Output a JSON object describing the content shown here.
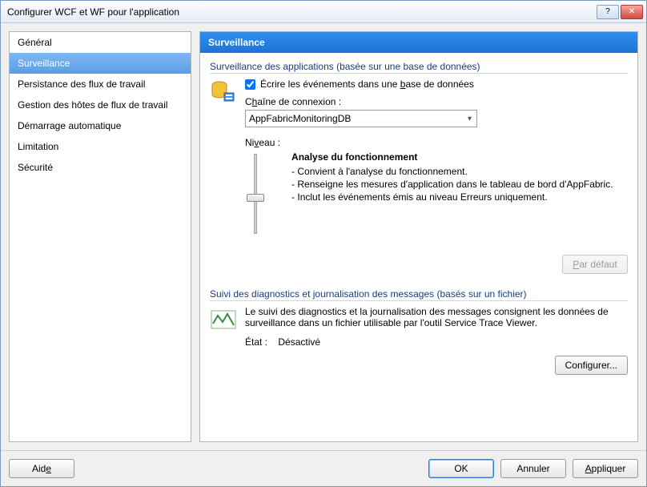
{
  "window": {
    "title": "Configurer WCF et WF pour l'application"
  },
  "sidebar": {
    "items": [
      {
        "label": "Général",
        "selected": false
      },
      {
        "label": "Surveillance",
        "selected": true
      },
      {
        "label": "Persistance des flux de travail",
        "selected": false
      },
      {
        "label": "Gestion des hôtes de flux de travail",
        "selected": false
      },
      {
        "label": "Démarrage automatique",
        "selected": false
      },
      {
        "label": "Limitation",
        "selected": false
      },
      {
        "label": "Sécurité",
        "selected": false
      }
    ]
  },
  "content": {
    "header": "Surveillance",
    "app_monitoring": {
      "group_title": "Surveillance des applications (basée sur une base de données)",
      "write_events_checkbox": {
        "checked": true,
        "label_pre": "Écrire les événements dans une ",
        "label_underlined": "b",
        "label_post": "ase de données"
      },
      "connection_label_pre": "C",
      "connection_label_underlined": "h",
      "connection_label_post": "aîne de connexion :",
      "connection_value": "AppFabricMonitoringDB",
      "level_label_pre": "Ni",
      "level_label_underlined": "v",
      "level_label_post": "eau :",
      "level": {
        "title": "Analyse du fonctionnement",
        "lines": [
          "- Convient à l'analyse du fonctionnement.",
          "- Renseigne les mesures d'application dans le tableau de bord d'AppFabric.",
          "- Inclut les événements émis au niveau Erreurs uniquement."
        ]
      },
      "default_button_pre": "",
      "default_button_underlined": "P",
      "default_button_post": "ar défaut",
      "default_button_enabled": false
    },
    "diagnostics": {
      "group_title": "Suivi des diagnostics et journalisation des messages (basés sur un fichier)",
      "description": "Le suivi des diagnostics et la journalisation des messages consignent les données de surveillance dans un fichier utilisable par l'outil Service Trace Viewer.",
      "state_label": "État :",
      "state_value": "Désactivé",
      "configure_button": "Configurer..."
    }
  },
  "footer": {
    "help_pre": "Aid",
    "help_underlined": "e",
    "ok": "OK",
    "cancel": "Annuler",
    "apply_underlined": "A",
    "apply_post": "ppliquer"
  }
}
